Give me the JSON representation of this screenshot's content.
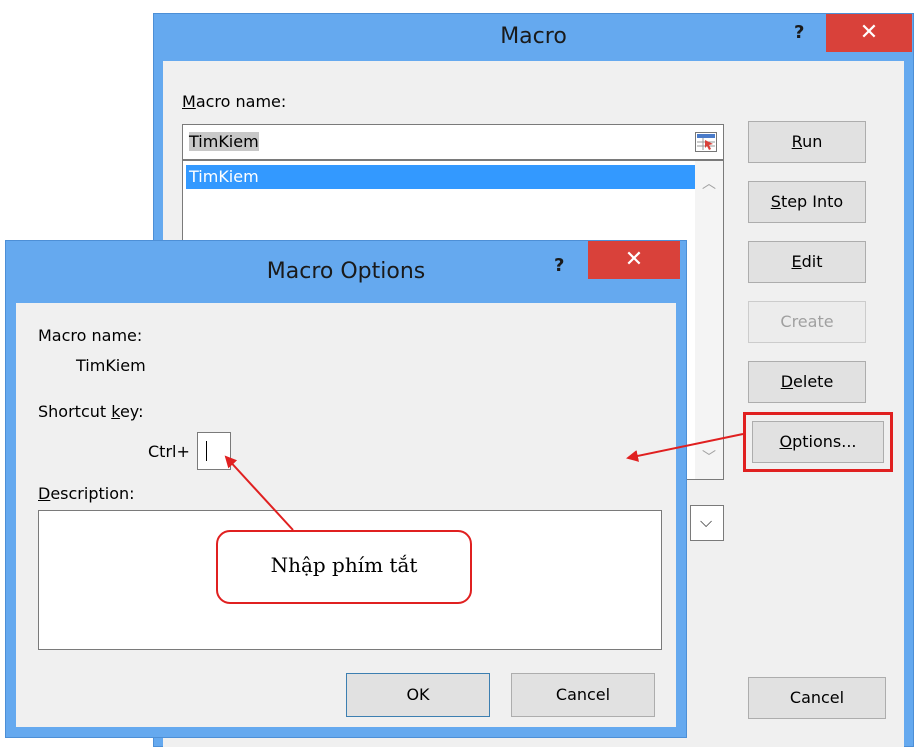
{
  "macro_dialog": {
    "title": "Macro",
    "help": "?",
    "close": "✕",
    "macro_name_label": "Macro name:",
    "macro_name_value": "TimKiem",
    "list_items": [
      "TimKiem"
    ],
    "buttons": {
      "run": {
        "pre": "",
        "key": "R",
        "post": "un"
      },
      "step_into": {
        "pre": "",
        "key": "S",
        "post": "tep Into"
      },
      "edit": {
        "pre": "",
        "key": "E",
        "post": "dit"
      },
      "create": "Create",
      "delete": {
        "pre": "",
        "key": "D",
        "post": "elete"
      },
      "options": {
        "pre": "",
        "key": "O",
        "post": "ptions..."
      },
      "cancel": "Cancel"
    }
  },
  "options_dialog": {
    "title": "Macro Options",
    "help": "?",
    "close": "✕",
    "macro_name_label": "Macro name:",
    "macro_name_value": "TimKiem",
    "shortcut_label": {
      "pre": "Shortcut ",
      "key": "k",
      "post": "ey:"
    },
    "ctrl_label": "Ctrl+",
    "shortcut_value": "",
    "description_label": {
      "pre": "",
      "key": "D",
      "post": "escription:"
    },
    "description_value": "",
    "ok": "OK",
    "cancel": "Cancel"
  },
  "annotation": {
    "callout_text": "Nhập phím tắt",
    "color": "#e02020"
  },
  "icons": {
    "refedit": "range-select-icon",
    "scroll_up": "chevron-up-icon",
    "scroll_down": "chevron-down-icon",
    "dropdown": "chevron-down-icon"
  },
  "colors": {
    "titlebar": "#65a9ef",
    "close": "#d9413a",
    "selection": "#3399ff",
    "client": "#f0f0f0"
  }
}
